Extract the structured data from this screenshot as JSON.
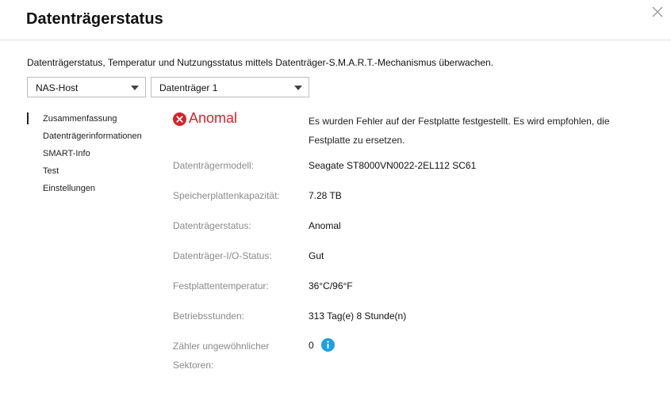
{
  "dialog": {
    "title": "Datenträgerstatus",
    "description": "Datenträgerstatus, Temperatur und Nutzungsstatus mittels Datenträger-S.M.A.R.T.-Mechanismus überwachen."
  },
  "selectors": {
    "host": "NAS-Host",
    "disk": "Datenträger 1"
  },
  "nav": {
    "items": [
      {
        "label": "Zusammenfassung",
        "active": true
      },
      {
        "label": "Datenträgerinformationen",
        "active": false
      },
      {
        "label": "SMART-Info",
        "active": false
      },
      {
        "label": "Test",
        "active": false
      },
      {
        "label": "Einstellungen",
        "active": false
      }
    ]
  },
  "summary": {
    "status": "Anomal",
    "status_color": "#d8222a",
    "message": "Es wurden Fehler auf der Festplatte festgestellt. Es wird empfohlen, die Festplatte zu ersetzen.",
    "rows": [
      {
        "label": "Datenträgermodell:",
        "value": "Seagate ST8000VN0022-2EL112 SC61"
      },
      {
        "label": "Speicherplattenkapazität:",
        "value": "7.28 TB"
      },
      {
        "label": "Datenträgerstatus:",
        "value": "Anomal"
      },
      {
        "label": "Datenträger-I/O-Status:",
        "value": "Gut"
      },
      {
        "label": "Festplattentemperatur:",
        "value": "36°C/96°F"
      },
      {
        "label": "Betriebsstunden:",
        "value": "313 Tag(e) 8 Stunde(n)"
      },
      {
        "label": "Zähler ungewöhnlicher",
        "label_line2": "Sektoren:",
        "value": "0"
      }
    ]
  },
  "icons": {
    "close": "close-icon",
    "error": "error-circle-icon",
    "info": "info-icon",
    "info_color": "#1ba1e2"
  }
}
